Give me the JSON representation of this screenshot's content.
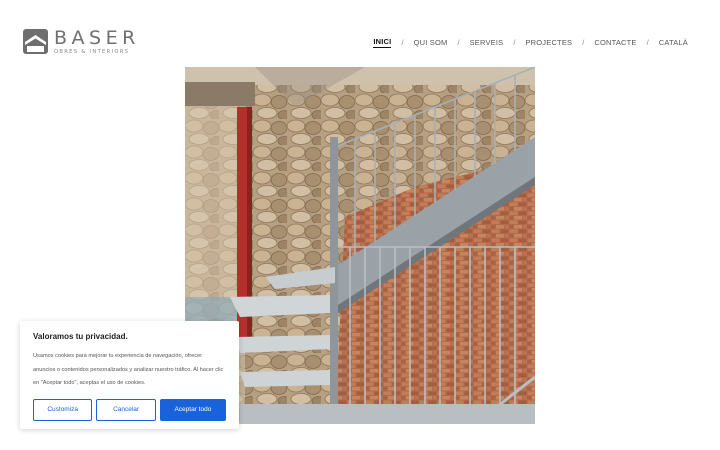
{
  "brand": {
    "name": "BASER",
    "tagline": "OBRES & INTERIORS",
    "logo_icon": "house-roof-icon"
  },
  "nav": {
    "items": [
      {
        "label": "INICI",
        "active": true
      },
      {
        "label": "QUI SOM"
      },
      {
        "label": "SERVEIS"
      },
      {
        "label": "PROJECTES"
      },
      {
        "label": "CONTACTE"
      },
      {
        "label": "CATALÀ"
      }
    ],
    "separator": "/"
  },
  "cookie": {
    "title": "Valoramos tu privacidad.",
    "text": "Usamos cookies para mejorar tu experiencia de navegación, ofrecer anuncios o contenidos personalizados y analizar nuestro tráfico. Al hacer clic en \"Aceptar todo\", aceptas el uso de cookies.",
    "customize_label": "Customiza",
    "cancel_label": "Cancelar",
    "accept_label": "Aceptar todo",
    "accent_color": "#1863dc"
  }
}
